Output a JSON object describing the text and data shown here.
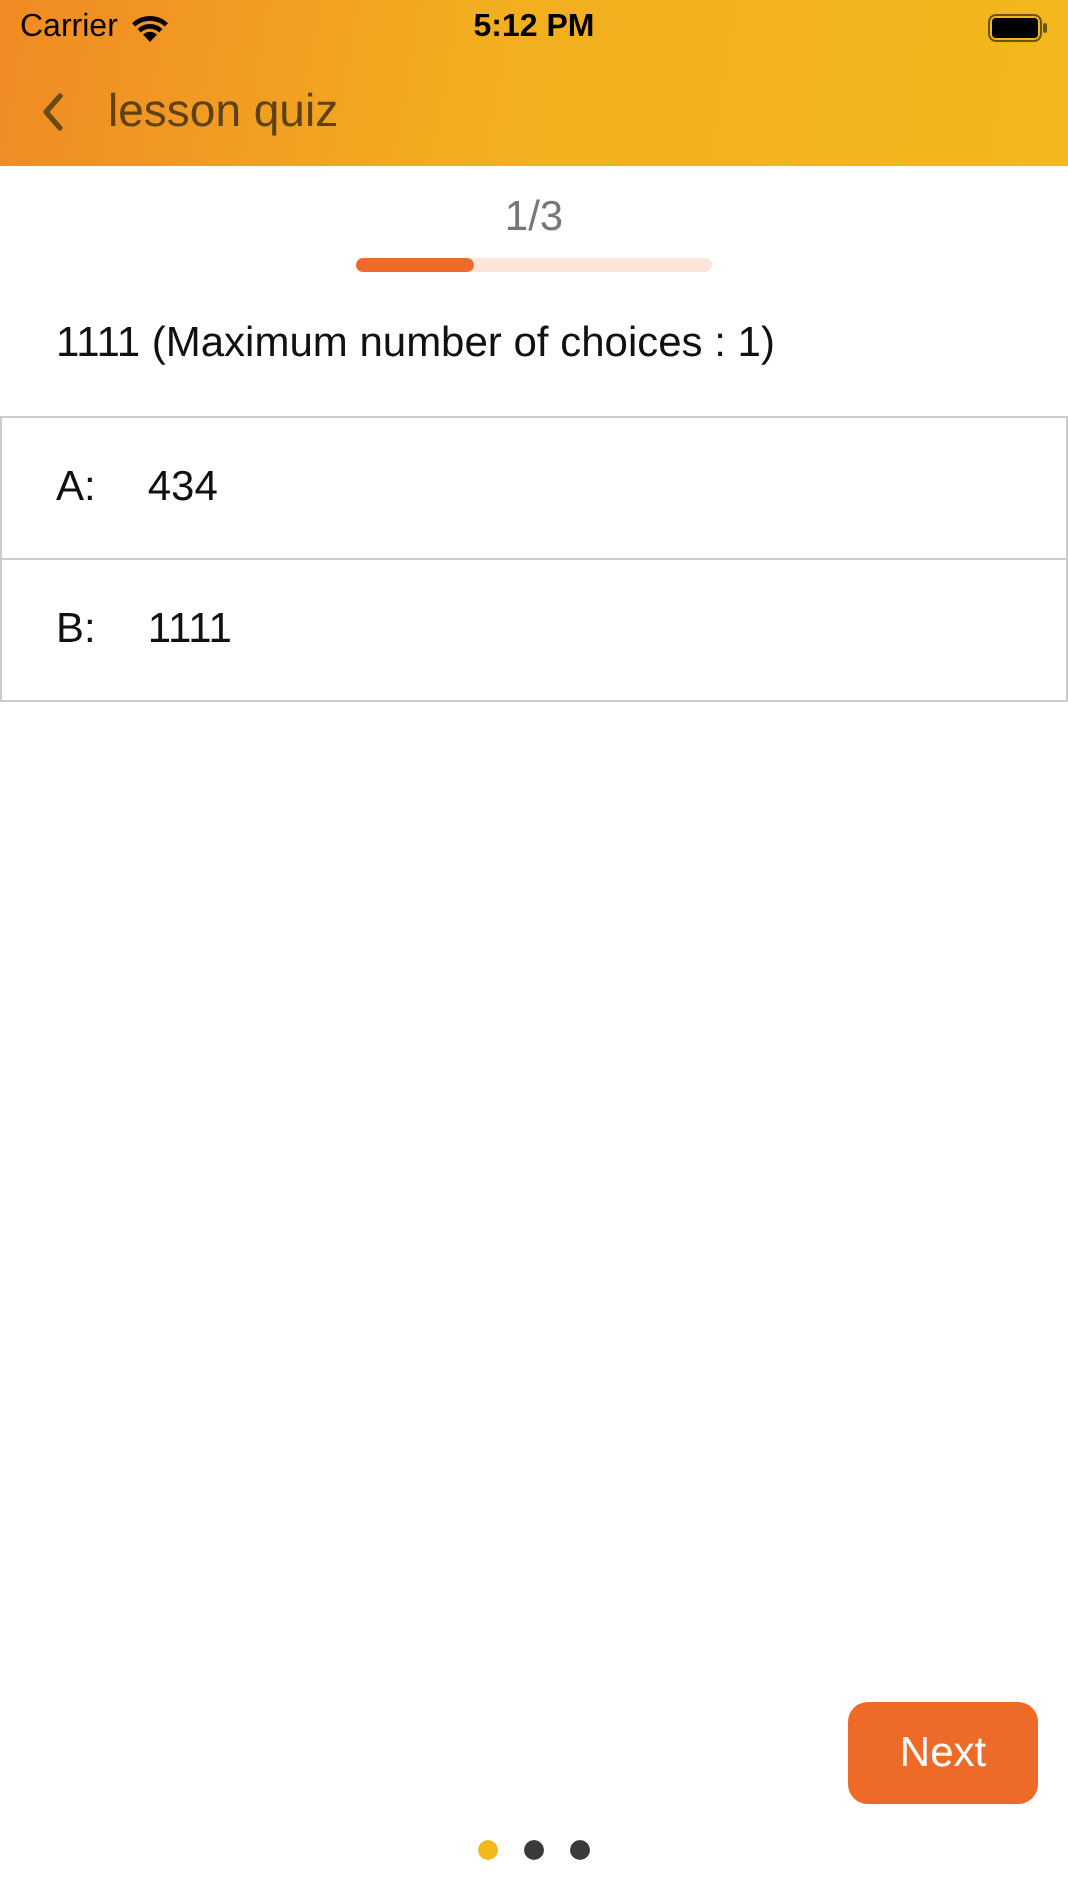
{
  "status_bar": {
    "carrier": "Carrier",
    "time": "5:12 PM"
  },
  "nav": {
    "title": "lesson quiz"
  },
  "progress": {
    "label": "1/3",
    "level": 0.33
  },
  "question": "1111 (Maximum number of choices : 1)",
  "options": [
    {
      "letter": "A:",
      "text": "434"
    },
    {
      "letter": "B:",
      "text": "1111"
    }
  ],
  "next_button": "Next",
  "page_dots": [
    {
      "selected": true
    },
    {
      "selected": false
    },
    {
      "selected": false
    }
  ]
}
